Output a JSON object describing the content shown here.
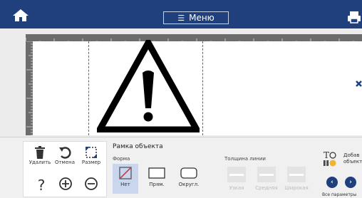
{
  "topbar": {
    "menu_label": "Меню",
    "home_icon": "home-icon",
    "print_icon": "printer-icon",
    "color": "#1f3f7d"
  },
  "canvas": {
    "symbol_icon": "warning-triangle-icon"
  },
  "tools": {
    "delete_label": "Удалить",
    "undo_label": "Отмена",
    "size_label": "Размер"
  },
  "frame_panel": {
    "title": "Рамка объекта",
    "form_label": "Форма",
    "shapes": [
      {
        "label": "Нет",
        "selected": true
      },
      {
        "label": "Прям.",
        "selected": false
      },
      {
        "label": "Округл.",
        "selected": false
      }
    ],
    "line_label": "Толщина линии",
    "line_widths": [
      {
        "label": "Узкая"
      },
      {
        "label": "Средняя"
      },
      {
        "label": "Широкая"
      }
    ]
  },
  "side": {
    "add_object_label_1": "Добав",
    "add_object_label_2": "объект",
    "params_label": "Все параметры"
  }
}
